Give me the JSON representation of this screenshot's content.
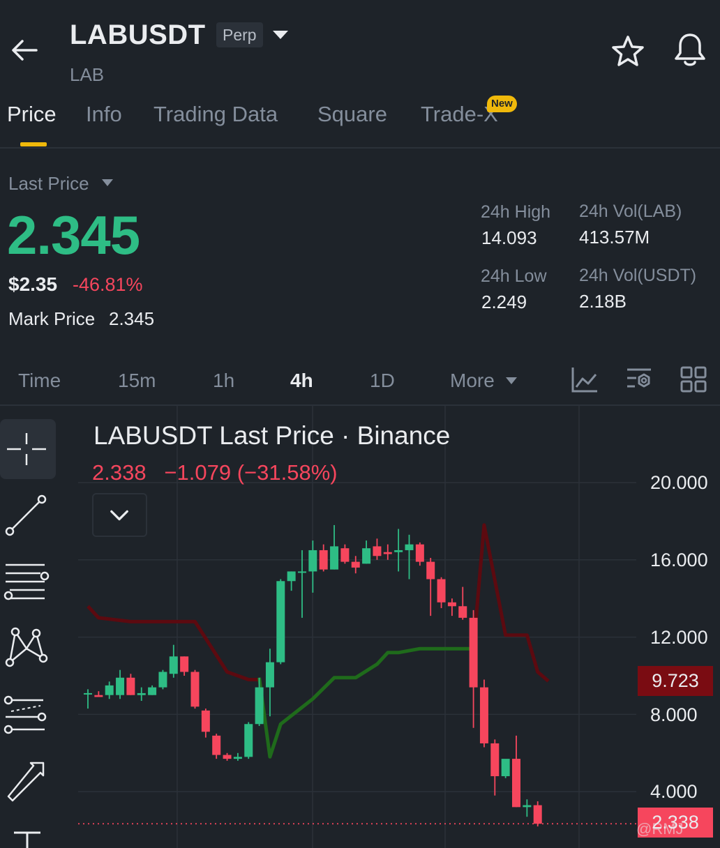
{
  "header": {
    "symbol": "LABUSDT",
    "contract_type": "Perp",
    "base_asset": "LAB",
    "icons": [
      "back-arrow-icon",
      "chevron-down-icon",
      "star-icon",
      "bell-icon"
    ]
  },
  "tabs": {
    "items": [
      {
        "label": "Price",
        "active": true
      },
      {
        "label": "Info",
        "active": false
      },
      {
        "label": "Trading Data",
        "active": false
      },
      {
        "label": "Square",
        "active": false
      },
      {
        "label": "Trade-X",
        "active": false,
        "badge": "New"
      }
    ]
  },
  "price": {
    "selector_label": "Last Price",
    "last_price": "2.345",
    "usd_price": "$2.35",
    "change_pct": "-46.81%",
    "mark_label": "Mark Price",
    "mark_value": "2.345"
  },
  "stats": {
    "high_label": "24h High",
    "high_value": "14.093",
    "low_label": "24h Low",
    "low_value": "2.249",
    "vol_base_label": "24h Vol(LAB)",
    "vol_base_value": "413.57M",
    "vol_quote_label": "24h Vol(USDT)",
    "vol_quote_value": "2.18B"
  },
  "intervals": {
    "items": [
      {
        "label": "Time",
        "active": false
      },
      {
        "label": "15m",
        "active": false
      },
      {
        "label": "1h",
        "active": false
      },
      {
        "label": "4h",
        "active": true
      },
      {
        "label": "1D",
        "active": false
      },
      {
        "label": "More",
        "active": false
      }
    ],
    "tool_icons": [
      "line-chart-icon",
      "indicator-settings-icon",
      "grid-layout-icon"
    ]
  },
  "drawing_tools": [
    "crosshair-icon",
    "trend-line-icon",
    "horizontal-lines-icon",
    "pattern-icon",
    "fib-retracement-icon",
    "arrow-icon",
    "text-tool-icon"
  ],
  "chart": {
    "title": "LABUSDT Last Price · Binance",
    "last": "2.338",
    "change": "−1.079",
    "change_pct": "(−31.58%)",
    "sar_tag": "9.723",
    "last_tag": "2.338",
    "watermark": "@RMJ",
    "colors": {
      "up": "#2ebd85",
      "down": "#f6465d",
      "sar_down": "#5c0a10",
      "sar_up": "#1f6b1b"
    }
  },
  "chart_data": {
    "type": "candlestick",
    "title": "LABUSDT Last Price · Binance",
    "ylim": [
      0,
      20
    ],
    "yticks": [
      "20.000",
      "16.000",
      "12.000",
      "8.000",
      "4.000"
    ],
    "interval": "4h",
    "candles": [
      {
        "o": 9.1,
        "h": 9.3,
        "l": 8.3,
        "c": 9.1
      },
      {
        "o": 9.0,
        "h": 9.2,
        "l": 8.9,
        "c": 8.9
      },
      {
        "o": 9.0,
        "h": 9.7,
        "l": 8.8,
        "c": 9.5
      },
      {
        "o": 9.0,
        "h": 10.3,
        "l": 8.8,
        "c": 9.9
      },
      {
        "o": 9.9,
        "h": 10.1,
        "l": 9.0,
        "c": 9.0
      },
      {
        "o": 9.0,
        "h": 9.4,
        "l": 8.7,
        "c": 9.1
      },
      {
        "o": 9.0,
        "h": 9.5,
        "l": 9.0,
        "c": 9.4
      },
      {
        "o": 9.4,
        "h": 10.3,
        "l": 9.3,
        "c": 10.2
      },
      {
        "o": 10.1,
        "h": 11.6,
        "l": 9.9,
        "c": 11.0
      },
      {
        "o": 11.0,
        "h": 11.0,
        "l": 10.0,
        "c": 10.2
      },
      {
        "o": 10.2,
        "h": 10.3,
        "l": 8.3,
        "c": 8.4
      },
      {
        "o": 8.2,
        "h": 8.3,
        "l": 6.8,
        "c": 7.1
      },
      {
        "o": 6.9,
        "h": 7.0,
        "l": 5.7,
        "c": 5.9
      },
      {
        "o": 5.9,
        "h": 6.0,
        "l": 5.6,
        "c": 5.7
      },
      {
        "o": 5.7,
        "h": 6.0,
        "l": 5.6,
        "c": 5.8
      },
      {
        "o": 5.8,
        "h": 7.6,
        "l": 5.7,
        "c": 7.5
      },
      {
        "o": 7.5,
        "h": 9.9,
        "l": 7.4,
        "c": 9.4
      },
      {
        "o": 9.4,
        "h": 11.4,
        "l": 7.9,
        "c": 10.7
      },
      {
        "o": 10.7,
        "h": 15.0,
        "l": 10.6,
        "c": 14.9
      },
      {
        "o": 14.9,
        "h": 15.4,
        "l": 14.4,
        "c": 15.4
      },
      {
        "o": 15.4,
        "h": 16.5,
        "l": 13.0,
        "c": 15.4
      },
      {
        "o": 15.4,
        "h": 17.0,
        "l": 14.3,
        "c": 16.5
      },
      {
        "o": 16.5,
        "h": 16.8,
        "l": 15.4,
        "c": 15.5
      },
      {
        "o": 15.5,
        "h": 17.8,
        "l": 15.5,
        "c": 16.7
      },
      {
        "o": 16.6,
        "h": 16.8,
        "l": 15.8,
        "c": 15.9
      },
      {
        "o": 15.9,
        "h": 16.2,
        "l": 15.3,
        "c": 15.6
      },
      {
        "o": 15.8,
        "h": 17.0,
        "l": 15.8,
        "c": 16.6
      },
      {
        "o": 16.7,
        "h": 17.1,
        "l": 16.0,
        "c": 16.2
      },
      {
        "o": 16.4,
        "h": 16.8,
        "l": 16.0,
        "c": 16.3
      },
      {
        "o": 16.4,
        "h": 17.6,
        "l": 15.4,
        "c": 16.5
      },
      {
        "o": 16.5,
        "h": 17.3,
        "l": 15.0,
        "c": 16.8
      },
      {
        "o": 16.8,
        "h": 16.9,
        "l": 15.7,
        "c": 15.9
      },
      {
        "o": 15.9,
        "h": 16.1,
        "l": 13.1,
        "c": 15.0
      },
      {
        "o": 15.0,
        "h": 15.1,
        "l": 13.5,
        "c": 13.8
      },
      {
        "o": 13.8,
        "h": 14.0,
        "l": 13.1,
        "c": 13.6
      },
      {
        "o": 13.6,
        "h": 14.6,
        "l": 12.9,
        "c": 13.0
      },
      {
        "o": 13.0,
        "h": 13.4,
        "l": 7.3,
        "c": 9.4
      },
      {
        "o": 9.4,
        "h": 9.8,
        "l": 6.3,
        "c": 6.5
      },
      {
        "o": 6.5,
        "h": 6.7,
        "l": 3.8,
        "c": 4.8
      },
      {
        "o": 4.8,
        "h": 5.6,
        "l": 4.7,
        "c": 5.7
      },
      {
        "o": 5.7,
        "h": 6.9,
        "l": 3.2,
        "c": 3.2
      },
      {
        "o": 3.2,
        "h": 3.6,
        "l": 2.7,
        "c": 3.3
      },
      {
        "o": 3.3,
        "h": 3.5,
        "l": 2.2,
        "c": 2.338
      }
    ],
    "sar_series": [
      {
        "name": "SAR (down)",
        "points": [
          [
            0,
            13.6
          ],
          [
            1,
            13.0
          ],
          [
            4,
            12.8
          ],
          [
            10,
            12.8
          ],
          [
            13,
            10.2
          ],
          [
            15,
            9.8
          ],
          [
            16,
            9.8
          ]
        ]
      },
      {
        "name": "SAR (up)",
        "points": [
          [
            16,
            9.9
          ],
          [
            17,
            5.8
          ],
          [
            18,
            7.5
          ],
          [
            21,
            8.8
          ],
          [
            23,
            9.9
          ],
          [
            25,
            9.9
          ],
          [
            27,
            10.6
          ],
          [
            28,
            11.2
          ],
          [
            29,
            11.2
          ],
          [
            31,
            11.4
          ],
          [
            36,
            11.4
          ]
        ]
      },
      {
        "name": "SAR (down 2)",
        "points": [
          [
            36,
            11.4
          ],
          [
            37,
            17.8
          ],
          [
            39,
            12.1
          ],
          [
            41,
            12.1
          ],
          [
            42,
            10.2
          ],
          [
            43,
            9.723
          ]
        ]
      }
    ]
  }
}
